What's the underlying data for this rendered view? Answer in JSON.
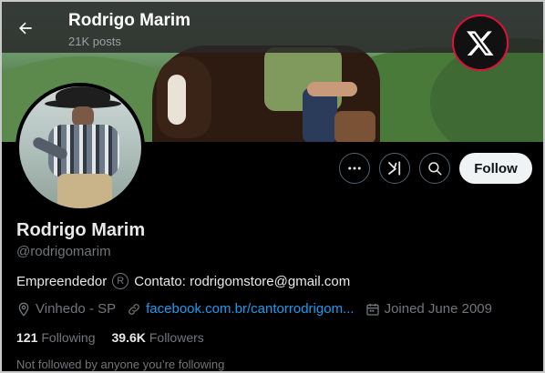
{
  "header": {
    "title": "Rodrigo Marim",
    "posts": "21K posts"
  },
  "profile": {
    "name": "Rodrigo Marim",
    "handle": "@rodrigomarim",
    "bio_text": "Empreendedor",
    "bio_symbol": "R",
    "bio_contact": "Contato: rodrigomstore@gmail.com",
    "location": "Vinhedo - SP",
    "website": "facebook.com.br/cantorrodrigom...",
    "joined": "Joined June 2009"
  },
  "stats": {
    "following_count": "121",
    "following_label": "Following",
    "followers_count": "39.6K",
    "followers_label": "Followers"
  },
  "buttons": {
    "follow_label": "Follow"
  },
  "not_followed": "Not followed by anyone you’re following",
  "icons": {
    "back": "arrow-left-icon",
    "badge": "x-logo-icon",
    "more": "more-icon",
    "grok": "grok-icon",
    "search": "search-icon",
    "location": "location-pin-icon",
    "link": "link-icon",
    "calendar": "calendar-icon"
  },
  "colors": {
    "background": "#000000",
    "link": "#1d9bf0",
    "muted": "#71767b",
    "badge_ring": "#e0113a",
    "follow_bg": "#eff3f4"
  }
}
